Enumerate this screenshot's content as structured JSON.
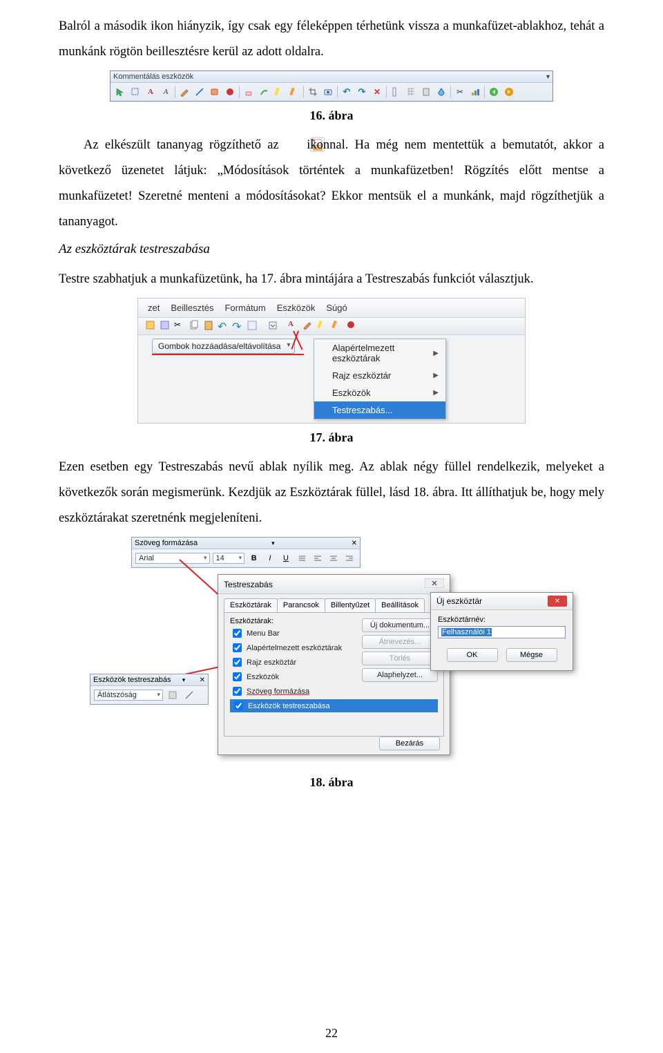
{
  "para1": "Balról a második ikon hiányzik, így csak egy féleképpen térhetünk vissza a munkafüzet-ablakhoz, tehát a munkánk rögtön beillesztésre kerül az adott oldalra.",
  "caption16": "16. ábra",
  "para2_pre": "Az elkészült tananyag rögzíthető az ",
  "para2_post": " ikonnal. Ha még nem mentettük a bemutatót, akkor a következő üzenetet látjuk: „Módosítások történtek a munkafüzetben! Rögzítés előtt mentse a munkafüzetet! Szeretné menteni a módosításokat? Ekkor mentsük el a munkánk, majd rögzíthetjük a tananyagot.",
  "subheading": "Az eszköztárak testreszabása",
  "para3": "Testre szabhatjuk a munkafüzetünk, ha 17. ábra mintájára a Testreszabás funkciót választjuk.",
  "caption17": "17. ábra",
  "para4": "Ezen esetben egy Testreszabás nevű ablak nyílik meg. Az ablak négy füllel rendelkezik, melyeket a következők során megismerünk. Kezdjük az Eszköztárak füllel, lásd 18. ábra. Itt állíthatjuk be, hogy mely eszköztárakat szeretnénk megjeleníteni.",
  "caption18": "18. ábra",
  "page_number": "22",
  "fig16": {
    "title": "Kommentálás eszközök"
  },
  "fig17": {
    "menu": {
      "m0": "zet",
      "m1": "Beillesztés",
      "m2": "Formátum",
      "m3": "Eszközök",
      "m4": "Súgó"
    },
    "button": "Gombok hozzáadása/eltávolítása",
    "submenu": {
      "i0": "Alapértelmezett eszköztárak",
      "i1": "Rajz eszköztár",
      "i2": "Eszközök",
      "i3": "Testreszabás..."
    }
  },
  "fig18": {
    "szoveg_title": "Szöveg formázása",
    "font_name": "Arial",
    "font_size": "14",
    "eszkoz_title": "Eszközök testreszabás",
    "atlatszosag": "Átlátszóság",
    "testreszabas": {
      "title": "Testreszabás",
      "tabs": {
        "t0": "Eszköztárak",
        "t1": "Parancsok",
        "t2": "Billentyűzet",
        "t3": "Beállítások"
      },
      "list_label": "Eszköztárak:",
      "items": {
        "i0": "Menu Bar",
        "i1": "Alapértelmezett eszköztárak",
        "i2": "Rajz eszköztár",
        "i3": "Eszközök",
        "i4": "Szöveg formázása",
        "i5": "Eszközök testreszabása"
      },
      "btns": {
        "b0": "Új dokumentum...",
        "b1": "Átnevezés...",
        "b2": "Törlés",
        "b3": "Alaphelyzet..."
      },
      "close": "Bezárás"
    },
    "uj": {
      "title": "Új eszköztár",
      "label": "Eszköztárnév:",
      "value": "Felhasználói 1",
      "ok": "OK",
      "cancel": "Mégse"
    }
  }
}
